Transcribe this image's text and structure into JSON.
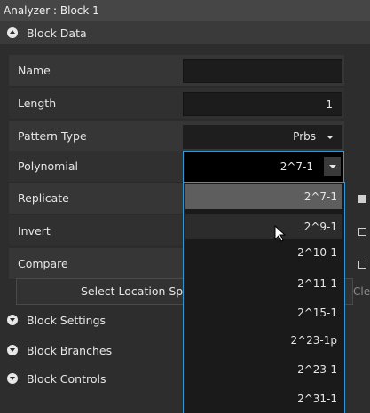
{
  "window": {
    "title": "Analyzer : Block  1"
  },
  "sections": {
    "block_data": "Block Data",
    "block_settings": "Block Settings",
    "block_branches": "Block Branches",
    "block_controls": "Block Controls"
  },
  "fields": {
    "name": {
      "label": "Name",
      "value": ""
    },
    "length": {
      "label": "Length",
      "value": "1"
    },
    "pattern_type": {
      "label": "Pattern Type",
      "value": "Prbs"
    },
    "polynomial": {
      "label": "Polynomial",
      "value": "2^7-1"
    },
    "replicate": {
      "label": "Replicate",
      "checked": true
    },
    "invert": {
      "label": "Invert",
      "checked": false
    },
    "compare": {
      "label": "Compare",
      "checked": false
    }
  },
  "buttons": {
    "select_location": "Select Location Sp",
    "clear": "Clear"
  },
  "polynomial_options": [
    "2^7-1",
    "2^9-1",
    "2^10-1",
    "2^11-1",
    "2^15-1",
    "2^23-1p",
    "2^23-1",
    "2^31-1"
  ],
  "colors": {
    "accent": "#2e97d4",
    "selected_item": "#5e5e5e"
  }
}
